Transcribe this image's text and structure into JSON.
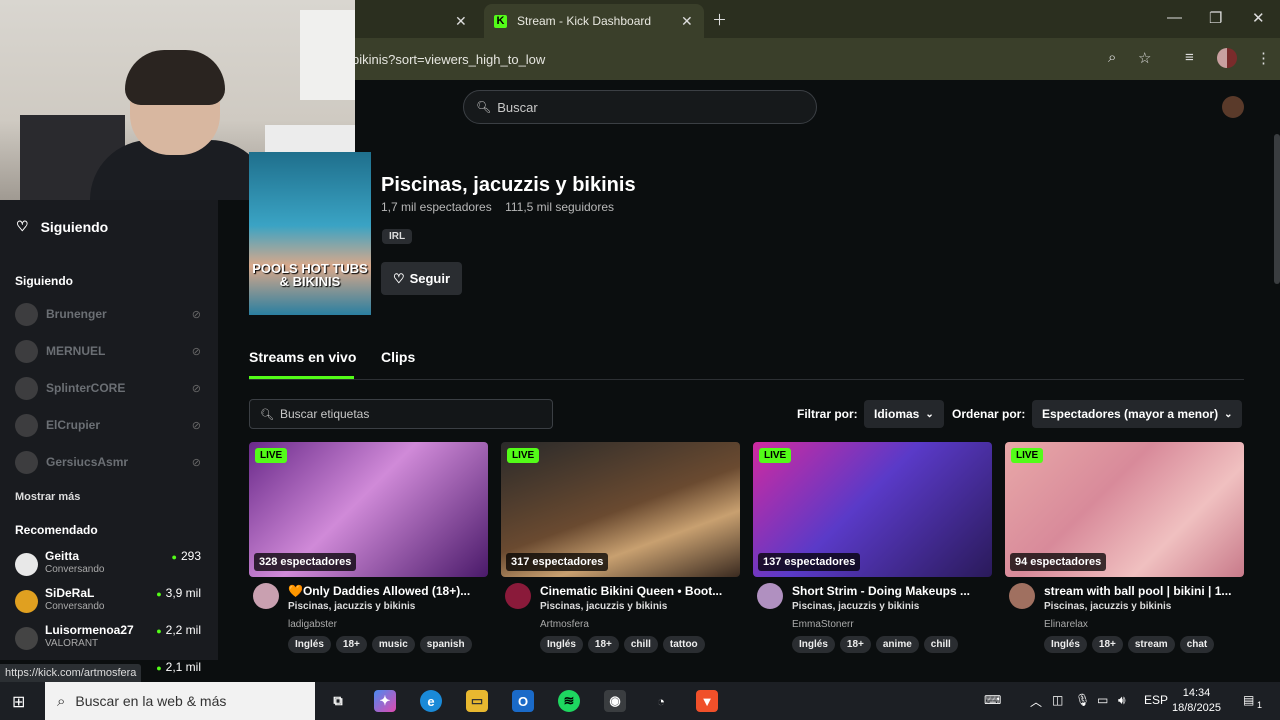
{
  "browser": {
    "tab_title": "Stream - Kick Dashboard",
    "url": "bikinis?sort=viewers_high_to_low",
    "hover_url": "https://kick.com/artmosfera"
  },
  "header": {
    "search_placeholder": "Buscar"
  },
  "sidebar": {
    "following_nav": "Siguiendo",
    "following_title": "Siguiendo",
    "following": [
      {
        "name": "Brunenger"
      },
      {
        "name": "MERNUEL"
      },
      {
        "name": "SplinterCORE"
      },
      {
        "name": "ElCrupier"
      },
      {
        "name": "GersiucsAsmr"
      }
    ],
    "show_more": "Mostrar más",
    "recommended_title": "Recomendado",
    "recommended": [
      {
        "name": "Geitta",
        "category": "Conversando",
        "viewers": "293",
        "color": "#e8e8e8"
      },
      {
        "name": "SiDeRaL",
        "category": "Conversando",
        "viewers": "3,9 mil",
        "color": "#e0a020"
      },
      {
        "name": "Luisormenoa27",
        "category": "VALORANT",
        "viewers": "2,2 mil",
        "color": "#444444"
      },
      {
        "name": "",
        "category": "",
        "viewers": "2,1 mil",
        "color": "#555555"
      }
    ]
  },
  "category": {
    "title": "Piscinas, jacuzzis y bikinis",
    "viewers": "1,7 mil espectadores",
    "followers": "111,5 mil seguidores",
    "tag": "IRL",
    "image_text": "POOLS HOT TUBS & BIKINIS",
    "follow_label": "Seguir"
  },
  "tabs": [
    {
      "label": "Streams en vivo",
      "active": true
    },
    {
      "label": "Clips",
      "active": false
    }
  ],
  "filters": {
    "tag_search_placeholder": "Buscar etiquetas",
    "filter_label": "Filtrar por:",
    "language_dropdown": "Idiomas",
    "sort_label": "Ordenar por:",
    "sort_dropdown": "Espectadores (mayor a menor)"
  },
  "streams": [
    {
      "live": "LIVE",
      "viewers": "328 espectadores",
      "title": "🧡Only Daddies Allowed (18+)...",
      "category": "Piscinas, jacuzzis y bikinis",
      "user": "ladigabster",
      "tags": [
        "Inglés",
        "18+",
        "music",
        "spanish"
      ],
      "thumb": "linear-gradient(135deg,#6a2a8a 0%,#d08ad8 45%,#4a1a6a 100%)",
      "avatar": "#c9a0b0"
    },
    {
      "live": "LIVE",
      "viewers": "317 espectadores",
      "title": "Cinematic Bikini Queen • Boot...",
      "category": "Piscinas, jacuzzis y bikinis",
      "user": "Artmosfera",
      "tags": [
        "Inglés",
        "18+",
        "chill",
        "tattoo"
      ],
      "thumb": "linear-gradient(160deg,#2a2a2a 0%,#6a4a30 50%,#c8a070 70%,#3a2a20 100%)",
      "avatar": "#8a1a3a"
    },
    {
      "live": "LIVE",
      "viewers": "137 espectadores",
      "title": "Short Strim - Doing Makeups ...",
      "category": "Piscinas, jacuzzis y bikinis",
      "user": "EmmaStonerr",
      "tags": [
        "Inglés",
        "18+",
        "anime",
        "chill"
      ],
      "thumb": "linear-gradient(135deg,#d02aa0 0%,#5a3ac8 45%,#2a1a5a 100%)",
      "avatar": "#b090c0"
    },
    {
      "live": "LIVE",
      "viewers": "94 espectadores",
      "title": "stream with ball pool | bikini | 1...",
      "category": "Piscinas, jacuzzis y bikinis",
      "user": "Elinarelax",
      "tags": [
        "Inglés",
        "18+",
        "stream",
        "chat"
      ],
      "thumb": "linear-gradient(135deg,#e8a8a8 0%,#d88a9a 40%,#f0c0c0 70%,#c87a8a 100%)",
      "avatar": "#a07060"
    }
  ],
  "taskbar": {
    "search_placeholder": "Buscar en la web & más",
    "language": "ESP",
    "time": "14:34",
    "date": "18/8/2025",
    "notifications": "1"
  },
  "colors": {
    "accent": "#53fc18",
    "background": "#0b0e0f",
    "sidebar": "#191b1f"
  }
}
